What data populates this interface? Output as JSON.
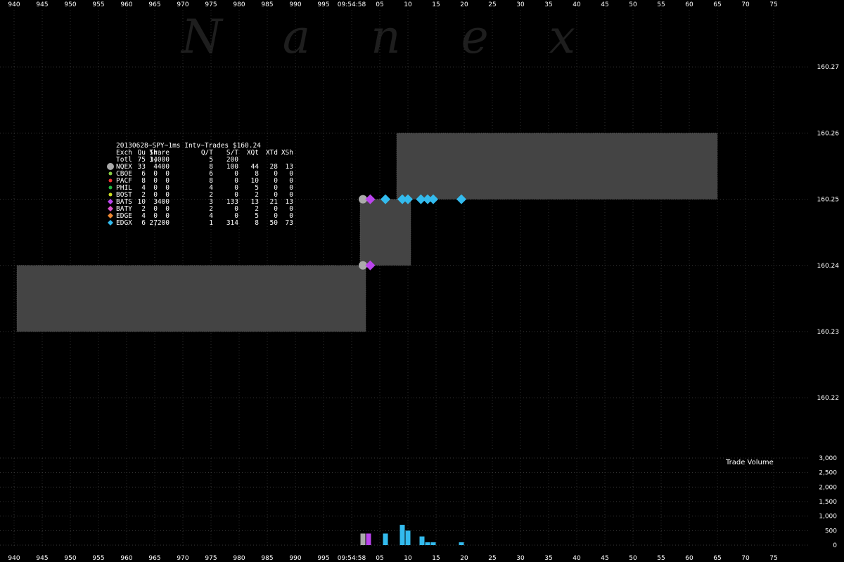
{
  "watermark": "N a n e x",
  "x_axis": {
    "ticks_left": [
      "940",
      "945",
      "950",
      "955",
      "960",
      "965",
      "970",
      "975",
      "980",
      "985",
      "990",
      "995"
    ],
    "time_label": "09:54:58",
    "ticks_right": [
      "05",
      "10",
      "15",
      "20",
      "25",
      "30",
      "35",
      "40",
      "45",
      "50",
      "55",
      "60",
      "65",
      "70",
      "75"
    ]
  },
  "legend": {
    "title": "20130628~SPY~1ms Intv~Trades $160.24",
    "headers": [
      "Exch",
      "Qu",
      "Tr",
      "Share",
      "Q/T",
      "S/T",
      "XQt",
      "XTd",
      "XSh"
    ],
    "total_row": [
      "Totl",
      "75",
      "14",
      "3,000",
      "5",
      "200",
      "",
      "",
      ""
    ],
    "rows": [
      {
        "cells": [
          "NQEX",
          "33",
          "4",
          "400",
          "8",
          "100",
          "44",
          "28",
          "13"
        ],
        "color": "#aaaaaa",
        "marker": "circle-large"
      },
      {
        "cells": [
          "CBOE",
          "6",
          "0",
          "0",
          "6",
          "0",
          "8",
          "0",
          "0"
        ],
        "color": "#88cc44",
        "marker": "circle"
      },
      {
        "cells": [
          "PACF",
          "8",
          "0",
          "0",
          "8",
          "0",
          "10",
          "0",
          "0"
        ],
        "color": "#ee3333",
        "marker": "circle"
      },
      {
        "cells": [
          "PHIL",
          "4",
          "0",
          "0",
          "4",
          "0",
          "5",
          "0",
          "0"
        ],
        "color": "#22bb44",
        "marker": "circle"
      },
      {
        "cells": [
          "BOST",
          "2",
          "0",
          "0",
          "2",
          "0",
          "2",
          "0",
          "0"
        ],
        "color": "#ccdd22",
        "marker": "circle"
      },
      {
        "cells": [
          "BATS",
          "10",
          "3",
          "400",
          "3",
          "133",
          "13",
          "21",
          "13"
        ],
        "color": "#bb44ee",
        "marker": "diamond"
      },
      {
        "cells": [
          "BATY",
          "2",
          "0",
          "0",
          "2",
          "0",
          "2",
          "0",
          "0"
        ],
        "color": "#dd55cc",
        "marker": "diamond"
      },
      {
        "cells": [
          "EDGE",
          "4",
          "0",
          "0",
          "4",
          "0",
          "5",
          "0",
          "0"
        ],
        "color": "#ee8833",
        "marker": "diamond"
      },
      {
        "cells": [
          "EDGX",
          "6",
          "7",
          "2,200",
          "1",
          "314",
          "8",
          "50",
          "73"
        ],
        "color": "#33bbee",
        "marker": "diamond"
      }
    ]
  },
  "chart_data": [
    {
      "type": "scatter",
      "description_units": "x in ms after 09:54:58.000 (negative = before); y in $",
      "xlim": [
        -60,
        75
      ],
      "ylim": [
        160.215,
        160.28
      ],
      "y_ticks": [
        "160.27",
        "160.26",
        "160.25",
        "160.24",
        "160.23",
        "160.22"
      ],
      "grid": true,
      "nbbo_boxes": [
        {
          "x0": -59.5,
          "x1": 2.5,
          "bid": 160.23,
          "ask": 160.24
        },
        {
          "x0": 1.5,
          "x1": 10.5,
          "bid": 160.24,
          "ask": 160.25
        },
        {
          "x0": 8,
          "x1": 65,
          "bid": 160.25,
          "ask": 160.26
        }
      ],
      "trades": [
        {
          "exch": "NQEX",
          "x": 2,
          "price": 160.25
        },
        {
          "exch": "BATS",
          "x": 3.3,
          "price": 160.25
        },
        {
          "exch": "EDGX",
          "x": 6,
          "price": 160.25
        },
        {
          "exch": "EDGX",
          "x": 9,
          "price": 160.25
        },
        {
          "exch": "EDGX",
          "x": 10,
          "price": 160.25
        },
        {
          "exch": "EDGX",
          "x": 12.3,
          "price": 160.25
        },
        {
          "exch": "EDGX",
          "x": 13.5,
          "price": 160.25
        },
        {
          "exch": "EDGX",
          "x": 14.5,
          "price": 160.25
        },
        {
          "exch": "EDGX",
          "x": 19.5,
          "price": 160.25
        },
        {
          "exch": "NQEX",
          "x": 2,
          "price": 160.24
        },
        {
          "exch": "BATS",
          "x": 3.3,
          "price": 160.24
        }
      ]
    },
    {
      "type": "bar",
      "title": "Trade Volume",
      "ylim": [
        0,
        3000
      ],
      "y_ticks": [
        "3,000",
        "2,500",
        "2,000",
        "1,500",
        "1,000",
        "500",
        "0"
      ],
      "bars": [
        {
          "x": 2,
          "value": 400,
          "color": "#aaaaaa"
        },
        {
          "x": 3,
          "value": 400,
          "color": "#bb44ee"
        },
        {
          "x": 6,
          "value": 400,
          "color": "#33bbee"
        },
        {
          "x": 9,
          "value": 700,
          "color": "#33bbee"
        },
        {
          "x": 10,
          "value": 500,
          "color": "#33bbee"
        },
        {
          "x": 12.5,
          "value": 300,
          "color": "#33bbee"
        },
        {
          "x": 13.5,
          "value": 100,
          "color": "#33bbee"
        },
        {
          "x": 14.5,
          "value": 100,
          "color": "#33bbee"
        },
        {
          "x": 19.5,
          "value": 100,
          "color": "#33bbee"
        }
      ]
    }
  ]
}
